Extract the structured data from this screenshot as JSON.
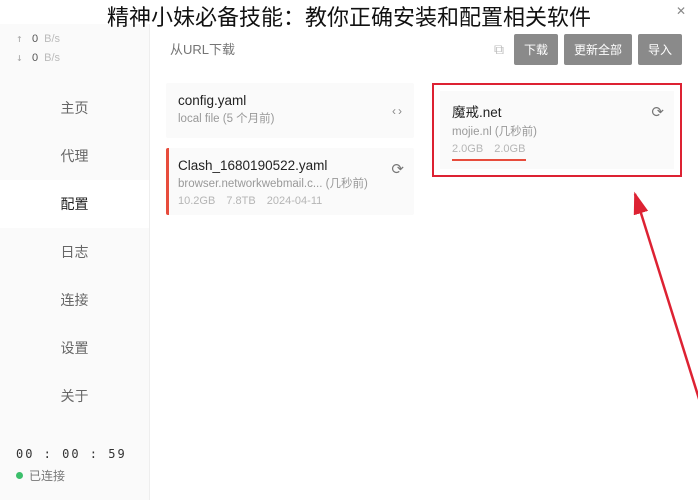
{
  "overlay_title": "精神小妹必备技能：教你正确安装和配置相关软件",
  "speed": {
    "up_arrow": "↑",
    "up_val": "0",
    "up_unit": "B/s",
    "down_arrow": "↓",
    "down_val": "0",
    "down_unit": "B/s"
  },
  "nav": {
    "home": "主页",
    "proxy": "代理",
    "config": "配置",
    "log": "日志",
    "conn": "连接",
    "settings": "设置",
    "about": "关于"
  },
  "footer": {
    "timer": "00 : 00 : 59",
    "status": "已连接"
  },
  "urlbar": {
    "placeholder": "从URL下载",
    "download": "下载",
    "update_all": "更新全部",
    "import": "导入"
  },
  "profiles": {
    "left": [
      {
        "title": "config.yaml",
        "sub": "local file (5 个月前)",
        "meta1": "",
        "meta2": "",
        "meta3": ""
      },
      {
        "title": "Clash_1680190522.yaml",
        "sub": "browser.networkwebmail.c...  (几秒前)",
        "meta1": "10.2GB",
        "meta2": "7.8TB",
        "meta3": "2024-04-11"
      }
    ],
    "highlight": {
      "title": "魔戒.net",
      "sub": "mojie.nl (几秒前)",
      "meta1": "2.0GB",
      "meta2": "2.0GB"
    }
  }
}
